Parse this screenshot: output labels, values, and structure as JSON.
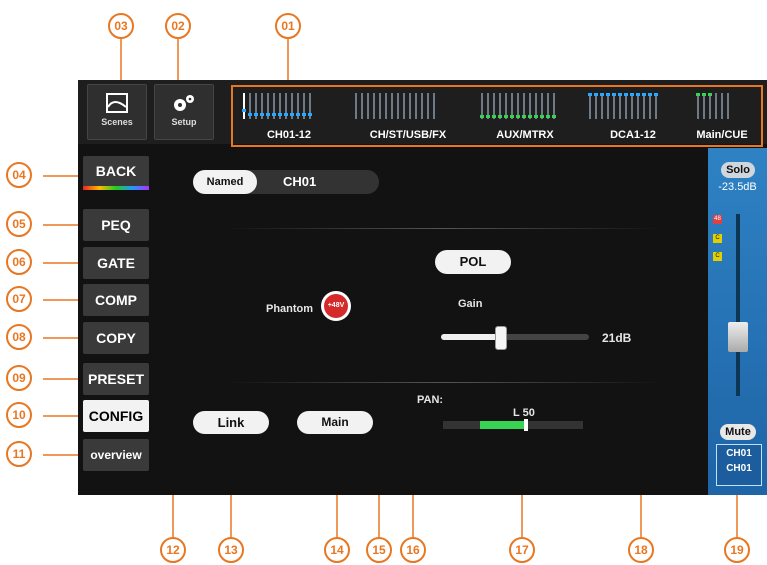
{
  "callouts": [
    "01",
    "02",
    "03",
    "04",
    "05",
    "06",
    "07",
    "08",
    "09",
    "10",
    "11",
    "12",
    "13",
    "14",
    "15",
    "16",
    "17",
    "18",
    "19"
  ],
  "topbar": {
    "scenes_label": "Scenes",
    "setup_label": "Setup",
    "meter_groups": [
      "CH01-12",
      "CH/ST/USB/FX",
      "AUX/MTRX",
      "DCA1-12",
      "Main/CUE"
    ]
  },
  "sidebar": {
    "items": [
      {
        "label": "BACK"
      },
      {
        "label": "PEQ"
      },
      {
        "label": "GATE"
      },
      {
        "label": "COMP"
      },
      {
        "label": "COPY"
      },
      {
        "label": "PRESET"
      },
      {
        "label": "CONFIG"
      },
      {
        "label": "overview"
      }
    ],
    "active": "CONFIG"
  },
  "main": {
    "named_label": "Named",
    "channel_name": "CH01",
    "phantom_label": "Phantom",
    "phantom_badge": "+48V",
    "pol_label": "POL",
    "gain_label": "Gain",
    "gain_value": "21dB",
    "gain_fraction": 0.4,
    "link_label": "Link",
    "main_label": "Main",
    "pan_label": "PAN:",
    "pan_value": "L 50"
  },
  "strip": {
    "solo_label": "Solo",
    "level": "-23.5dB",
    "tags": [
      "48",
      "C",
      "C"
    ],
    "mute_label": "Mute",
    "channel_top": "CH01",
    "channel_bottom": "CH01"
  },
  "colors": {
    "callout": "#e87722",
    "meter_blue": "#2aa8ff",
    "meter_green": "#39d353",
    "phantom_red": "#d42a2a",
    "strip_blue": "#2e82c4"
  }
}
